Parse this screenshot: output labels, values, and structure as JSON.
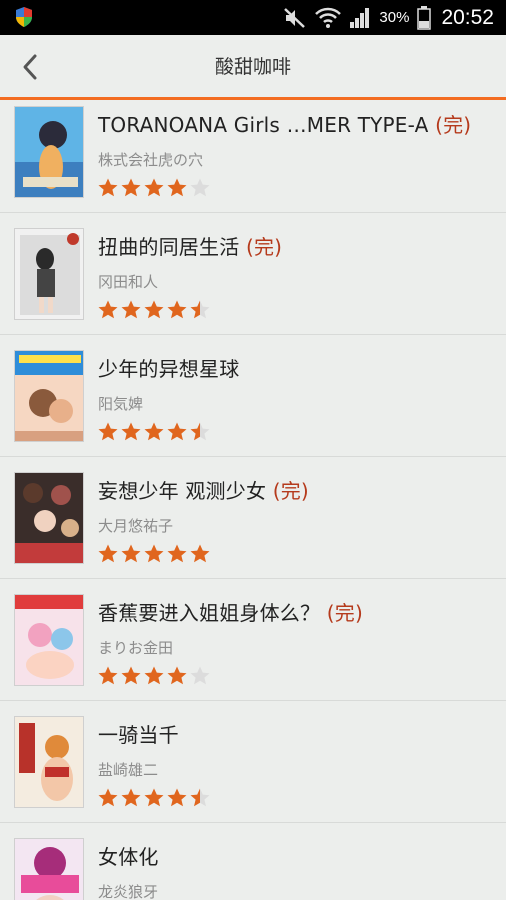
{
  "status": {
    "battery": "30%",
    "time": "20:52"
  },
  "header": {
    "title": "酸甜咖啡"
  },
  "colors": {
    "accent": "#f36c21",
    "star": "#e0661e",
    "done": "#b53a1c"
  },
  "books": [
    {
      "title": "TORANOANA Girls …MER TYPE-A",
      "done": "(完)",
      "author": "株式会社虎の穴",
      "rating": 4
    },
    {
      "title": "扭曲的同居生活",
      "done": "(完)",
      "author": "冈田和人",
      "rating": 4.5
    },
    {
      "title": "少年的异想星球",
      "done": "",
      "author": "阳気婢",
      "rating": 4.5
    },
    {
      "title": "妄想少年 观测少女",
      "done": "(完)",
      "author": "大月悠祐子",
      "rating": 5
    },
    {
      "title": "香蕉要进入姐姐身体么？",
      "done": "(完)",
      "author": "まりお金田",
      "rating": 4
    },
    {
      "title": "一骑当千",
      "done": "",
      "author": "盐崎雄二",
      "rating": 4.5
    },
    {
      "title": "女体化",
      "done": "",
      "author": "龙炎狼牙",
      "rating": 0
    }
  ]
}
